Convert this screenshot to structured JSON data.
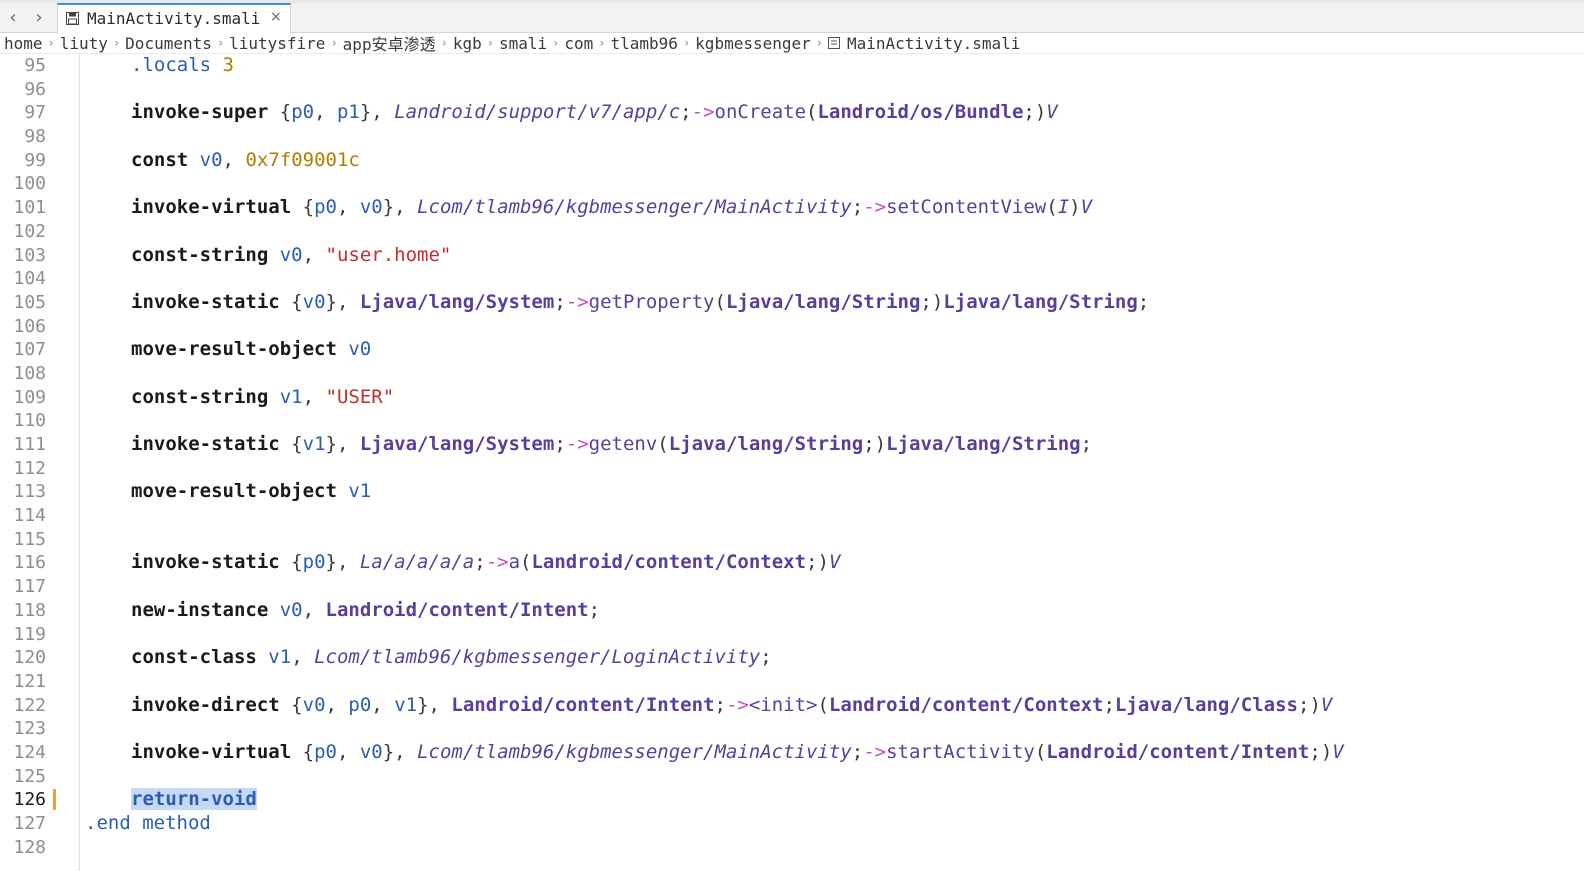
{
  "nav": {
    "back_glyph": "‹",
    "forward_glyph": "›"
  },
  "tab": {
    "title": "MainActivity.smali",
    "icon": "save-disk-icon",
    "close_glyph": "×"
  },
  "breadcrumb": {
    "items": [
      "home",
      "liuty",
      "Documents",
      "liutysfire",
      "app安卓渗透",
      "kgb",
      "smali",
      "com",
      "tlamb96",
      "kgbmessenger",
      "MainActivity.smali"
    ],
    "separator": "›"
  },
  "editor": {
    "current_line": 126,
    "line_numbers": [
      "95",
      "96",
      "97",
      "98",
      "99",
      "100",
      "101",
      "102",
      "103",
      "104",
      "105",
      "106",
      "107",
      "108",
      "109",
      "110",
      "111",
      "112",
      "113",
      "114",
      "115",
      "116",
      "117",
      "118",
      "119",
      "120",
      "121",
      "122",
      "123",
      "124",
      "125",
      "126",
      "127",
      "128"
    ],
    "lines": {
      "l95": {
        "dir": ".locals",
        "num": "3"
      },
      "l97": {
        "kw": "invoke-super",
        "p1": "{",
        "r1": "p0",
        "c1": ", ",
        "r2": "p1",
        "p2": "}, ",
        "t1": "Landroid/support/v7/app/c",
        "sc": ";",
        "arrow": "->",
        "m": "onCreate",
        "lp": "(",
        "t2": "Landroid/os/Bundle",
        "sc2": ";",
        "rp": ")",
        "ret": "V"
      },
      "l99": {
        "kw": "const",
        "r1": "v0",
        "c": ", ",
        "num": "0x7f09001c"
      },
      "l101": {
        "kw": "invoke-virtual",
        "p1": "{",
        "r1": "p0",
        "c1": ", ",
        "r2": "v0",
        "p2": "}, ",
        "t1": "Lcom/tlamb96/kgbmessenger/MainActivity",
        "sc": ";",
        "arrow": "->",
        "m": "setContentView",
        "lp": "(",
        "t2": "I",
        "rp": ")",
        "ret": "V"
      },
      "l103": {
        "kw": "const-string",
        "r1": "v0",
        "c": ", ",
        "str": "\"user.home\""
      },
      "l105": {
        "kw": "invoke-static",
        "p1": "{",
        "r1": "v0",
        "p2": "}, ",
        "t1": "Ljava/lang/System",
        "sc": ";",
        "arrow": "->",
        "m": "getProperty",
        "lp": "(",
        "t2": "Ljava/lang/String",
        "sc2": ";",
        "rp": ")",
        "t3": "Ljava/lang/String",
        "sc3": ";"
      },
      "l107": {
        "kw": "move-result-object",
        "r1": "v0"
      },
      "l109": {
        "kw": "const-string",
        "r1": "v1",
        "c": ", ",
        "str": "\"USER\""
      },
      "l111": {
        "kw": "invoke-static",
        "p1": "{",
        "r1": "v1",
        "p2": "}, ",
        "t1": "Ljava/lang/System",
        "sc": ";",
        "arrow": "->",
        "m": "getenv",
        "lp": "(",
        "t2": "Ljava/lang/String",
        "sc2": ";",
        "rp": ")",
        "t3": "Ljava/lang/String",
        "sc3": ";"
      },
      "l113": {
        "kw": "move-result-object",
        "r1": "v1"
      },
      "l116": {
        "kw": "invoke-static",
        "p1": "{",
        "r1": "p0",
        "p2": "}, ",
        "t1": "La/a/a/a/a",
        "sc": ";",
        "arrow": "->",
        "m": "a",
        "lp": "(",
        "t2": "Landroid/content/Context",
        "sc2": ";",
        "rp": ")",
        "ret": "V"
      },
      "l118": {
        "kw": "new-instance",
        "r1": "v0",
        "c": ", ",
        "t1": "Landroid/content/Intent",
        "sc": ";"
      },
      "l120": {
        "kw": "const-class",
        "r1": "v1",
        "c": ", ",
        "t1": "Lcom/tlamb96/kgbmessenger/LoginActivity",
        "sc": ";"
      },
      "l122": {
        "kw": "invoke-direct",
        "p1": "{",
        "r1": "v0",
        "c1": ", ",
        "r2": "p0",
        "c2": ", ",
        "r3": "v1",
        "p2": "}, ",
        "t1": "Landroid/content/Intent",
        "sc": ";",
        "arrow": "->",
        "m": "<init>",
        "lp": "(",
        "t2": "Landroid/content/Context",
        "sc2": ";",
        "t3": "Ljava/lang/Class",
        "sc3": ";",
        "rp": ")",
        "ret": "V"
      },
      "l124": {
        "kw": "invoke-virtual",
        "p1": "{",
        "r1": "p0",
        "c1": ", ",
        "r2": "v0",
        "p2": "}, ",
        "t1": "Lcom/tlamb96/kgbmessenger/MainActivity",
        "sc": ";",
        "arrow": "->",
        "m": "startActivity",
        "lp": "(",
        "t2": "Landroid/content/Intent",
        "sc2": ";",
        "rp": ")",
        "ret": "V"
      },
      "l126": {
        "sel": "return-void"
      },
      "l127": {
        "dir": ".end method"
      }
    }
  },
  "colors": {
    "keyword": "#1a1a1a",
    "register": "#2a5db0",
    "type": "#5b3d9c",
    "arrow": "#c24fc0",
    "string": "#c22d2d",
    "number": "#b07d00",
    "selection": "#c5d9f3",
    "tab_accent": "#4a8ad4",
    "modified_marker": "#e8a33c"
  }
}
